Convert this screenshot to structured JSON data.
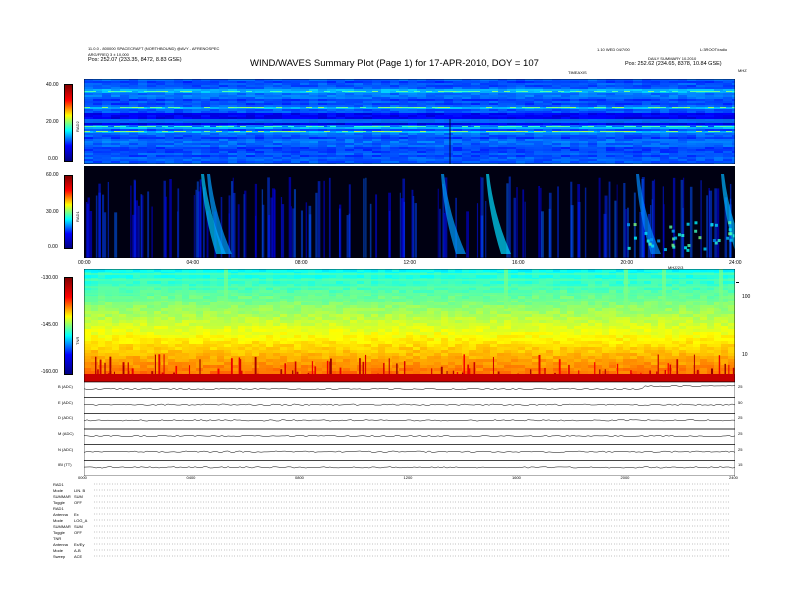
{
  "header": {
    "left_line1": "11.0.0 - 800000 SPACECRAFT (NORTHBOUND) @AVY - AFRENOSPEC",
    "left_line2": "ARG/FREQ 3 ± 10,000",
    "left_line3": "Pos:   252.07 (233.35, 8472, 8.83 GSE)",
    "right_line1": "1.10 WED 04/7/00",
    "right_line1b": "L:3ROOT/radio",
    "right_line2": "DAILY SUMMARY 10.2010",
    "right_line3": "Pos:   252.62 (234.65, 8378, 10.84 GSE)",
    "title": "WIND/WAVES Summary Plot (Page 1) for 17-APR-2010, DOY = 107",
    "sub_marker": "TIMEAXIS",
    "sub_marker_right": "MHZ"
  },
  "chart_data": [
    {
      "type": "heatmap",
      "name": "RAD2",
      "ylabel": "RAD2",
      "y_ticks": [
        "40.00",
        "20.00",
        "0.00"
      ],
      "ylim": [
        0,
        40
      ],
      "colorscale": "jet"
    },
    {
      "type": "heatmap",
      "name": "RAD1",
      "ylabel": "RAD1",
      "y_ticks": [
        "60.00",
        "30.00",
        "0.00"
      ],
      "ylim": [
        0,
        60
      ],
      "colorscale": "jet",
      "x_ticks": [
        "00:00",
        "04:00",
        "08:00",
        "12:00",
        "16:00",
        "20:00",
        "24:00"
      ],
      "x_range_hours": [
        0,
        24
      ]
    },
    {
      "type": "heatmap",
      "name": "TNR",
      "ylabel": "TNR",
      "y_ticks": [
        "-130.00",
        "-145.00",
        "-160.00"
      ],
      "ylim": [
        -160,
        -130
      ],
      "right_ticks": [
        "100",
        "10"
      ],
      "right_marker": "MHZ/2/3",
      "colorscale": "jet"
    },
    {
      "type": "line",
      "name": "timeseries",
      "rows": [
        {
          "label": "B (ADC)",
          "right": "25"
        },
        {
          "label": "E (ADC)",
          "right": "50"
        },
        {
          "label": "D (ADC)",
          "right": "25"
        },
        {
          "label": "M (ADC)",
          "right": "25"
        },
        {
          "label": "N (ADC)",
          "right": "25"
        },
        {
          "label": "IBI (TT)",
          "right": "15"
        }
      ],
      "x_ticks": [
        "0000",
        "0400",
        "0800",
        "1200",
        "1600",
        "2000",
        "2400"
      ],
      "x_range_hours": [
        0,
        24
      ]
    }
  ],
  "footer": [
    {
      "label": "RAD1",
      "value": ""
    },
    {
      "label": "Mode",
      "value": "LIN. B"
    },
    {
      "label": "SUMMAR",
      "value": "SUM"
    },
    {
      "label": "Toggle",
      "value": "OFF"
    },
    {
      "label": "RAD1",
      "value": ""
    },
    {
      "label": "Antenna",
      "value": "Ex"
    },
    {
      "label": "Mode",
      "value": "LOG_A"
    },
    {
      "label": "SUMMAR",
      "value": "SUM"
    },
    {
      "label": "Toggle",
      "value": "OFF"
    },
    {
      "label": "TNR",
      "value": ""
    },
    {
      "label": "Antenna",
      "value": "Ex/Ey"
    },
    {
      "label": "Mode",
      "value": "A-B"
    },
    {
      "label": "Sweep",
      "value": "ACE"
    }
  ]
}
